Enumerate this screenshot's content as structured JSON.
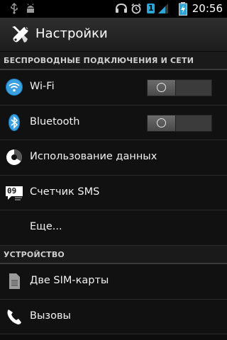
{
  "status_bar": {
    "time": "20:56",
    "sim_badge": "1",
    "icons": [
      "usb-icon",
      "android-debug-icon",
      "headset-icon",
      "alarm-icon",
      "wifi-signal-icon",
      "cell-signal-icon",
      "battery-charging-icon"
    ]
  },
  "action_bar": {
    "title": "Настройки",
    "icon": "settings-tools-icon"
  },
  "sections": {
    "wireless": {
      "header": "БЕСПРОВОДНЫЕ ПОДКЛЮЧЕНИЯ И СЕТИ",
      "items": [
        {
          "label": "Wi-Fi",
          "icon": "wifi-icon",
          "toggle": "О"
        },
        {
          "label": "Bluetooth",
          "icon": "bluetooth-icon",
          "toggle": "О"
        },
        {
          "label": "Использование данных",
          "icon": "data-usage-icon"
        },
        {
          "label": "Счетчик SMS",
          "icon": "sms-counter-icon",
          "icon_text": "09"
        },
        {
          "label": "Еще..."
        }
      ]
    },
    "device": {
      "header": "УСТРОЙСТВО",
      "items": [
        {
          "label": "Две SIM-карты",
          "icon": "sim-card-icon"
        },
        {
          "label": "Вызовы",
          "icon": "phone-icon"
        }
      ]
    }
  },
  "colors": {
    "accent": "#33b5e5",
    "background": "#111111",
    "header_bg": "#1a1a1a",
    "charge_accent": "#2aa6d8"
  }
}
